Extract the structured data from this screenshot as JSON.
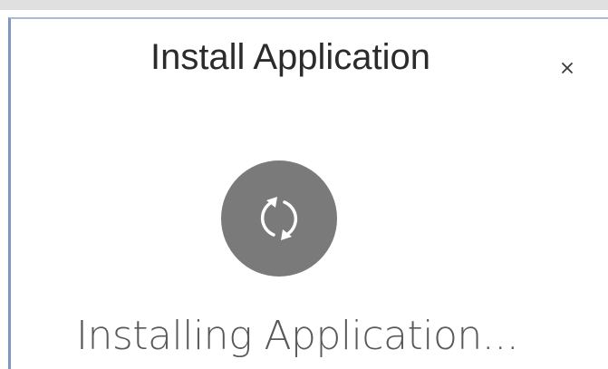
{
  "dialog": {
    "title": "Install Application",
    "close_label": "×",
    "status_text": "Installing Application..."
  },
  "icons": {
    "spinner": "sync-arrows-icon",
    "close": "close-icon"
  },
  "colors": {
    "spinner_background": "#7a7a7a",
    "title_text": "#2b2b2b",
    "status_text": "#595959",
    "dialog_border": "#7d97c0"
  }
}
